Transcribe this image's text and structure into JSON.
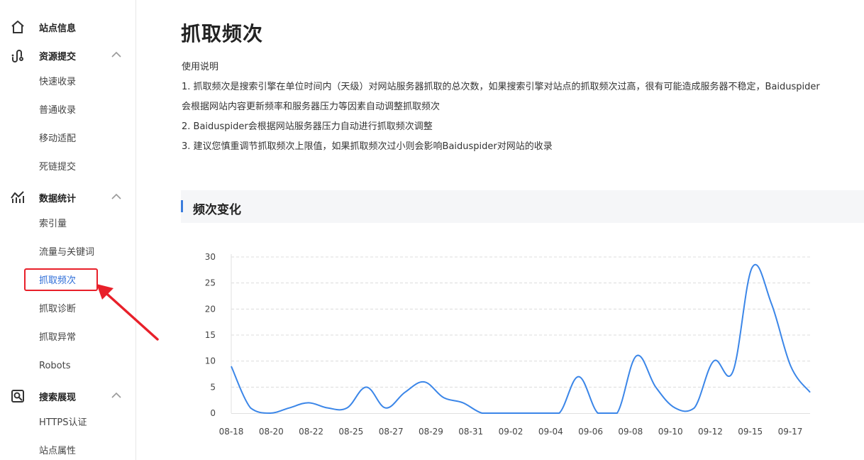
{
  "sidebar": {
    "site_info": {
      "label": "站点信息",
      "icon": "home-icon"
    },
    "resource_submit": {
      "label": "资源提交",
      "icon": "link-icon",
      "items": [
        "快速收录",
        "普通收录",
        "移动适配",
        "死链提交"
      ]
    },
    "data_stats": {
      "label": "数据统计",
      "icon": "stats-icon",
      "items": [
        "索引量",
        "流量与关键词",
        "抓取频次",
        "抓取诊断",
        "抓取异常",
        "Robots"
      ],
      "active": "抓取频次"
    },
    "search_display": {
      "label": "搜索展现",
      "icon": "search-display-icon",
      "items": [
        "HTTPS认证",
        "站点属性"
      ]
    }
  },
  "main": {
    "title": "抓取频次",
    "instructions": {
      "heading": "使用说明",
      "lines": [
        "1. 抓取频次是搜索引擎在单位时间内（天级）对网站服务器抓取的总次数，如果搜索引擎对站点的抓取频次过高，很有可能造成服务器不稳定，Baiduspider",
        "会根据网站内容更新频率和服务器压力等因素自动调整抓取频次",
        "2. Baiduspider会根据网站服务器压力自动进行抓取频次调整",
        "3. 建议您慎重调节抓取频次上限值，如果抓取频次过小则会影响Baiduspider对网站的收录"
      ]
    },
    "section_title": "频次变化"
  },
  "colors": {
    "accent": "#3b7ddd",
    "line": "#3b86e8",
    "highlight": "#e8202a"
  },
  "chart_data": {
    "type": "line",
    "title": "",
    "xlabel": "",
    "ylabel": "",
    "ylim": [
      0,
      30
    ],
    "yticks": [
      0,
      5,
      10,
      15,
      20,
      25,
      30
    ],
    "x_tick_labels": [
      "08-18",
      "08-20",
      "08-22",
      "08-25",
      "08-27",
      "08-29",
      "08-31",
      "09-02",
      "09-04",
      "09-06",
      "09-08",
      "09-10",
      "09-12",
      "09-15",
      "09-17"
    ],
    "grid": "horizontal dashed",
    "series": [
      {
        "values": [
          9,
          1,
          0,
          1,
          2,
          1,
          1,
          5,
          1,
          4,
          6,
          3,
          2,
          0,
          0,
          0,
          0,
          0,
          7,
          0,
          0,
          11,
          5,
          1,
          1,
          10,
          8,
          28,
          21,
          9,
          4
        ]
      }
    ]
  }
}
